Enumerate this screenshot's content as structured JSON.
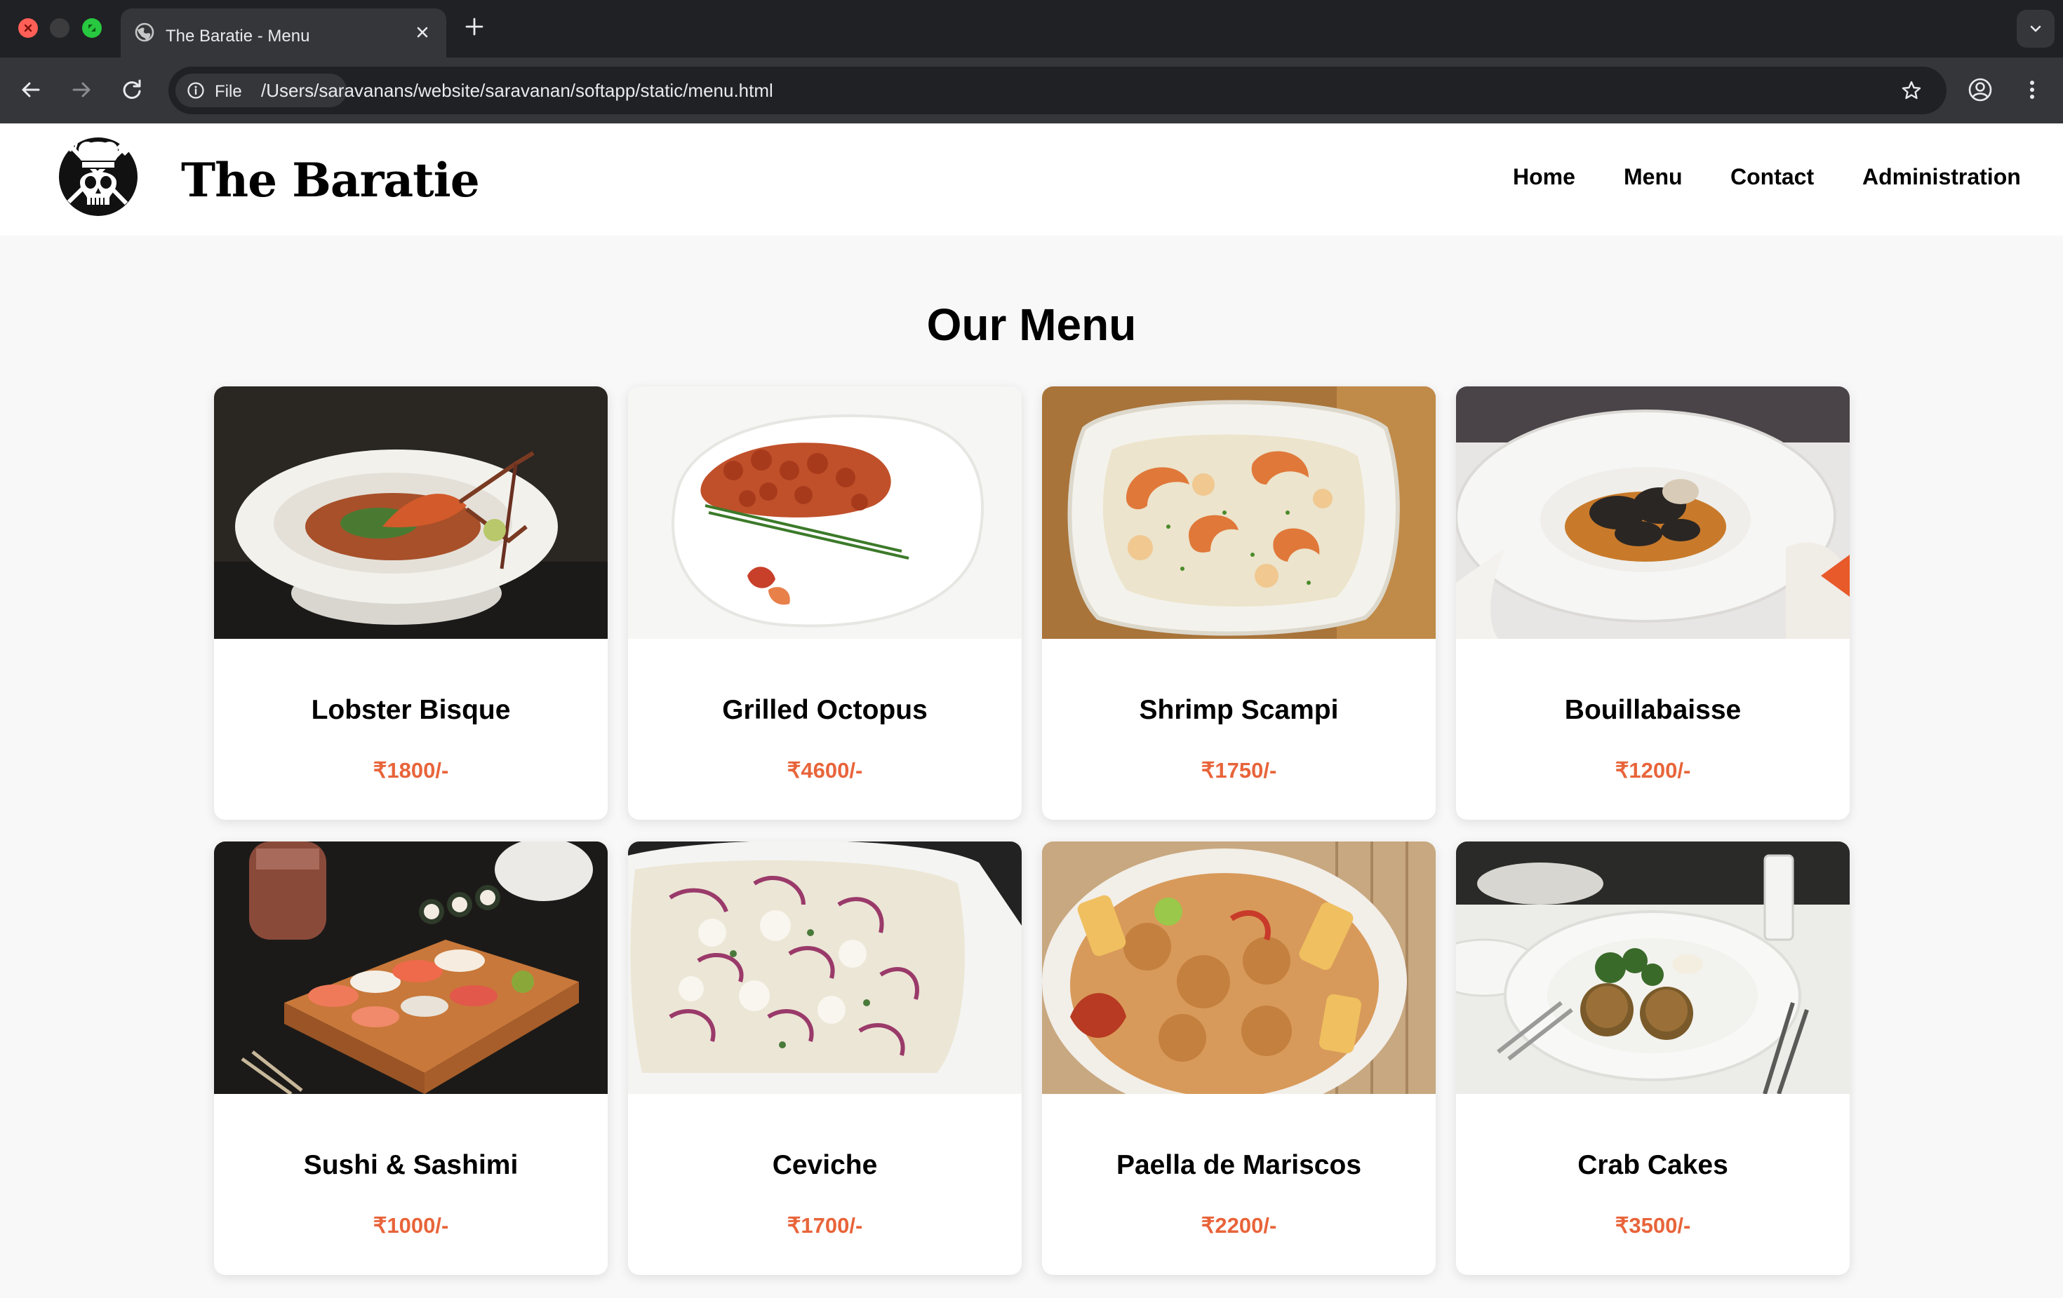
{
  "browser": {
    "tab_title": "The Baratie - Menu",
    "chip_label": "File",
    "url": "/Users/saravanans/website/saravanan/softapp/static/menu.html"
  },
  "site": {
    "brand": "The Baratie",
    "nav": [
      "Home",
      "Menu",
      "Contact",
      "Administration"
    ]
  },
  "page": {
    "title": "Our Menu"
  },
  "menu": [
    {
      "name": "Lobster Bisque",
      "price": "₹1800/-"
    },
    {
      "name": "Grilled Octopus",
      "price": "₹4600/-"
    },
    {
      "name": "Shrimp Scampi",
      "price": "₹1750/-"
    },
    {
      "name": "Bouillabaisse",
      "price": "₹1200/-"
    },
    {
      "name": "Sushi & Sashimi",
      "price": "₹1000/-"
    },
    {
      "name": "Ceviche",
      "price": "₹1700/-"
    },
    {
      "name": "Paella de Mariscos",
      "price": "₹2200/-"
    },
    {
      "name": "Crab Cakes",
      "price": "₹3500/-"
    }
  ],
  "colors": {
    "price": "#e8643a",
    "chrome_dark": "#202124",
    "chrome_tab": "#35363a",
    "page_bg": "#f8f8f8"
  }
}
